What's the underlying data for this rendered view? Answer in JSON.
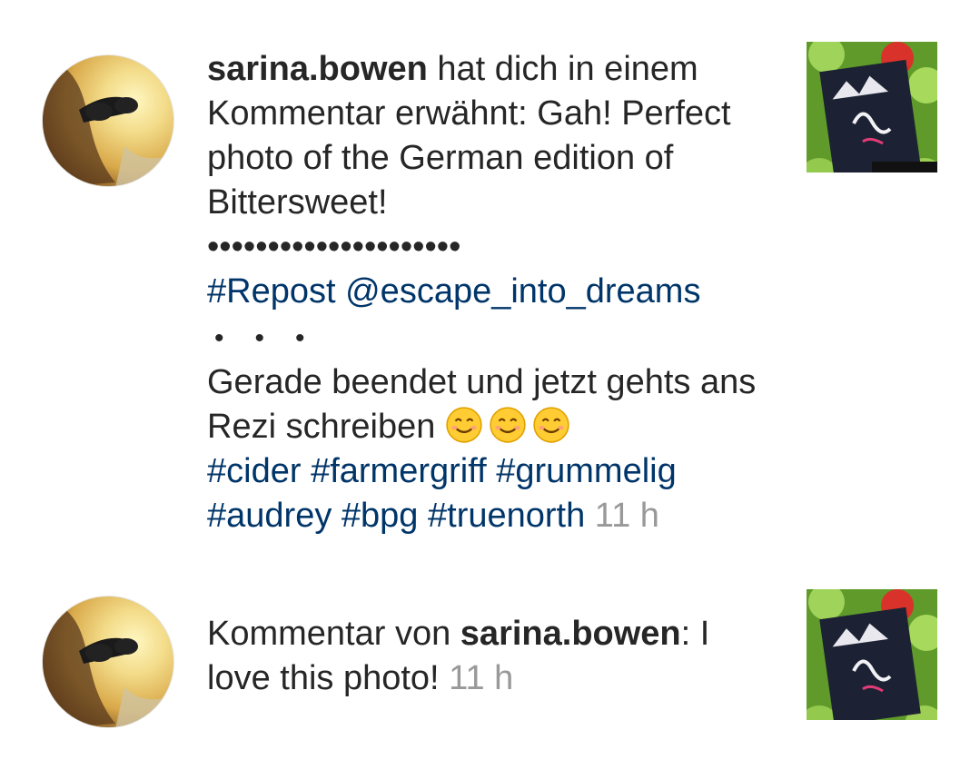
{
  "notifications": [
    {
      "username": "sarina.bowen",
      "text_after_user": " hat dich in einem Kommentar erwähnt: Gah! Perfect photo of the German edition of Bittersweet!",
      "bullets": "•••••••••••••••••••••",
      "tag_repost": "#Repost",
      "mention": "@escape_into_dreams",
      "bullets_small": "•••",
      "body": "Gerade beendet und jetzt gehts ans Rezi schreiben ",
      "tags": [
        "#cider",
        "#farmergriff",
        "#grummelig",
        "#audrey",
        "#bpg",
        "#truenorth"
      ],
      "time": "11 h"
    },
    {
      "prefix": "Kommentar von ",
      "username": "sarina.bowen",
      "text_after_user": ": I love this photo!",
      "time": "11 h"
    }
  ]
}
